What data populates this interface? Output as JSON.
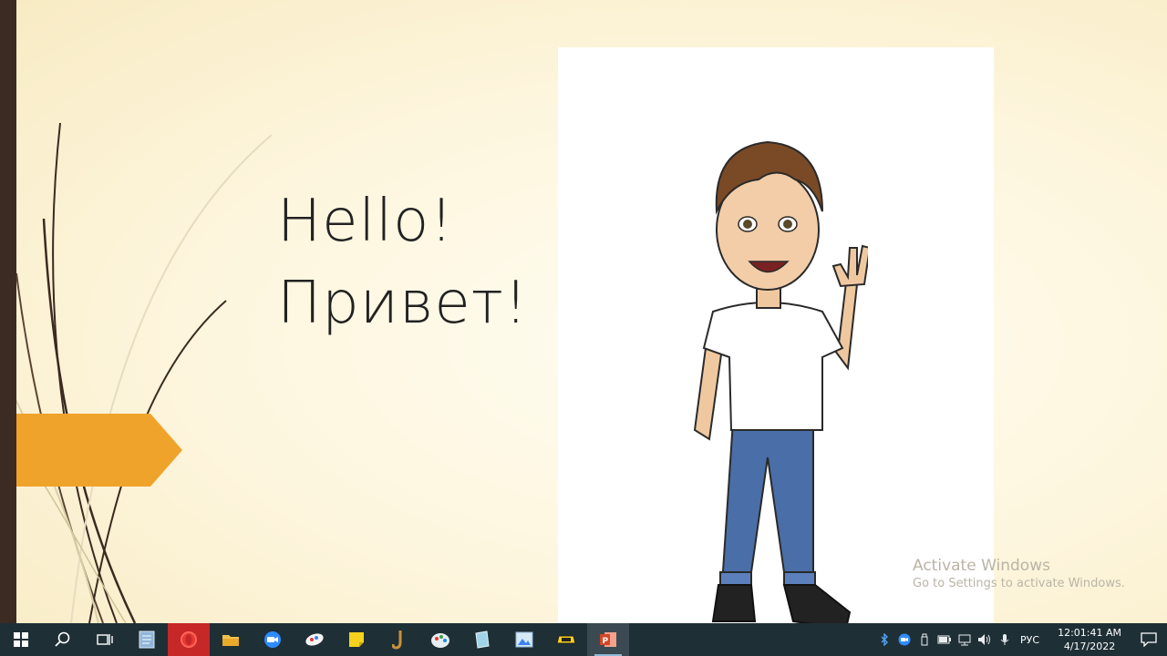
{
  "slide": {
    "title_line1": "Hello!",
    "title_line2": "Привет!",
    "accent_color": "#f0a32a"
  },
  "watermark": {
    "title": "Activate Windows",
    "subtitle": "Go to Settings to activate Windows."
  },
  "taskbar": {
    "apps": [
      {
        "name": "start-button",
        "icon": "windows-logo-icon"
      },
      {
        "name": "search-button",
        "icon": "search-icon"
      },
      {
        "name": "task-view-button",
        "icon": "task-view-icon"
      },
      {
        "name": "app-notepad",
        "icon": "document-icon"
      },
      {
        "name": "app-opera",
        "icon": "opera-icon"
      },
      {
        "name": "app-file-explorer",
        "icon": "folder-icon"
      },
      {
        "name": "app-zoom",
        "icon": "camera-icon"
      },
      {
        "name": "app-paint-3d",
        "icon": "paint-icon"
      },
      {
        "name": "app-sticky-notes",
        "icon": "sticky-note-icon"
      },
      {
        "name": "app-sax",
        "icon": "saxophone-icon"
      },
      {
        "name": "app-paint",
        "icon": "palette-icon"
      },
      {
        "name": "app-notebook",
        "icon": "book-icon"
      },
      {
        "name": "app-photos",
        "icon": "picture-icon"
      },
      {
        "name": "app-rw",
        "icon": "rw-icon"
      },
      {
        "name": "app-powerpoint",
        "icon": "powerpoint-icon"
      }
    ],
    "tray": {
      "language": "РУС",
      "time": "12:01:41 AM",
      "date": "4/17/2022"
    }
  }
}
